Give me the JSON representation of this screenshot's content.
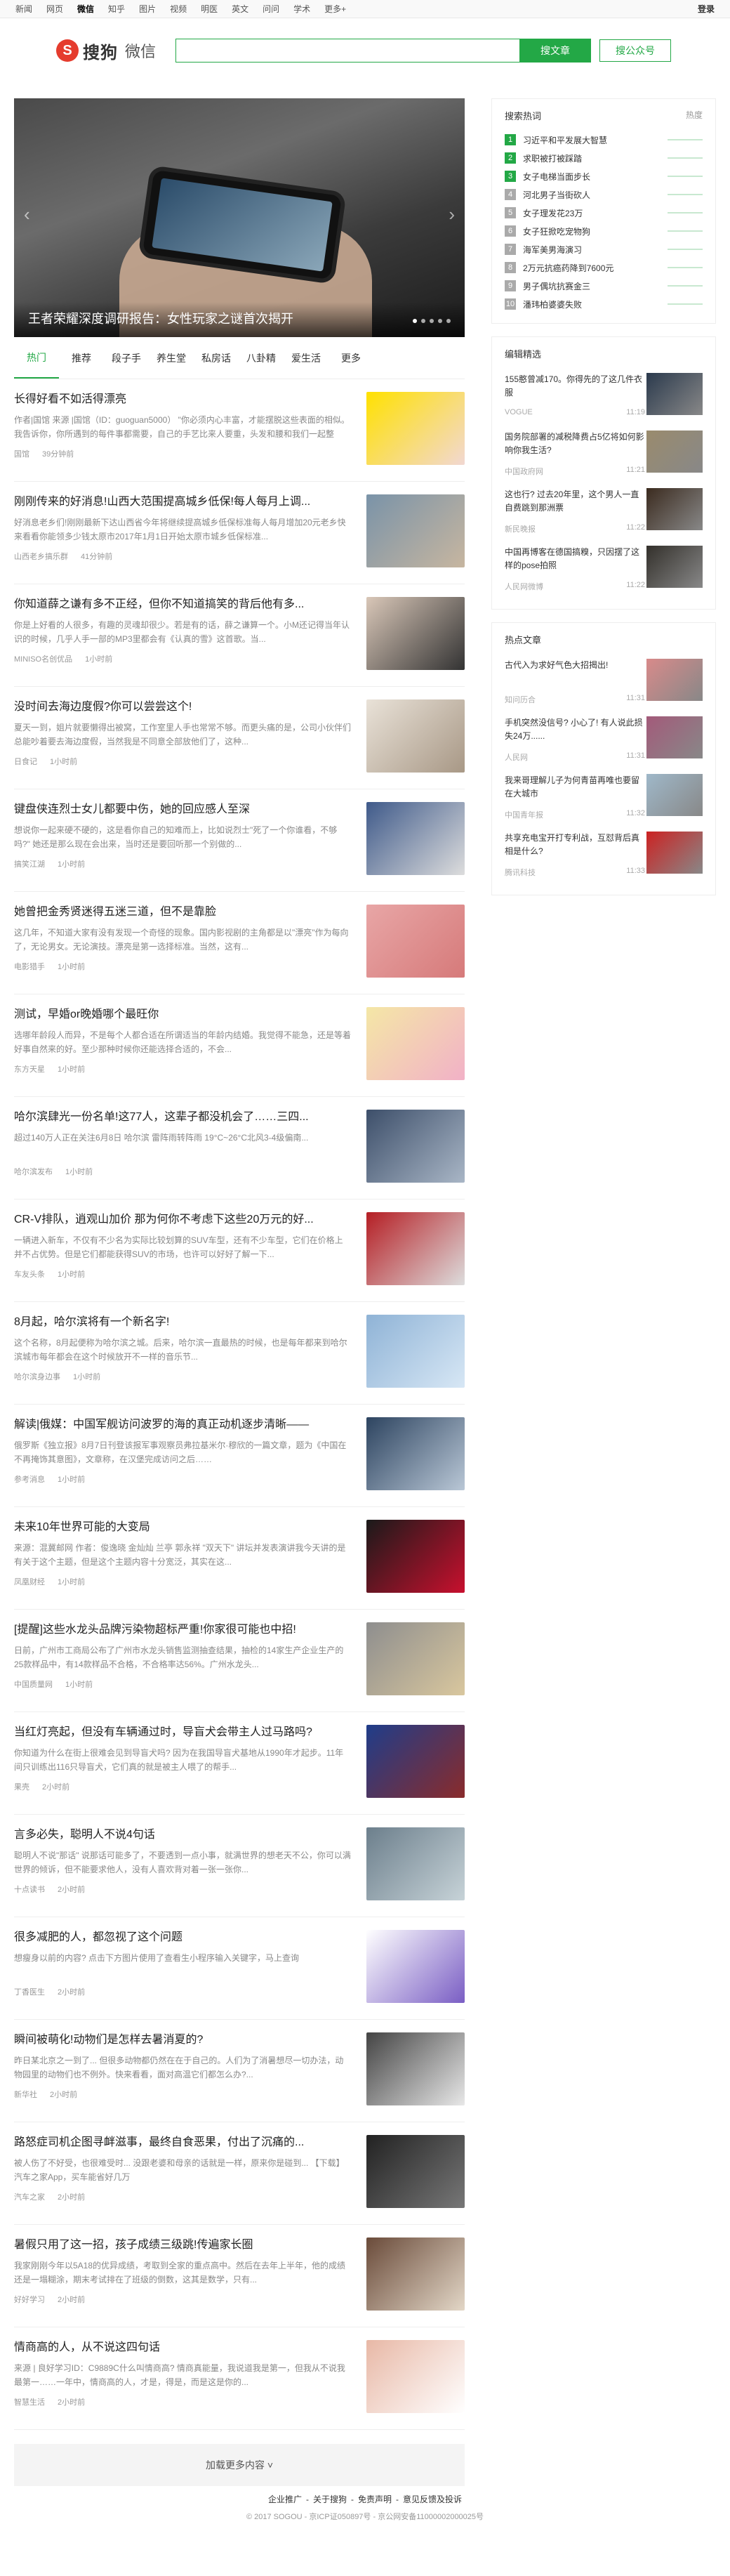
{
  "topnav": {
    "items": [
      "新闻",
      "网页",
      "微信",
      "知乎",
      "图片",
      "视频",
      "明医",
      "英文",
      "问问",
      "学术",
      "更多+"
    ],
    "active_index": 2,
    "login": "登录"
  },
  "brand": {
    "logo_letter": "S",
    "logo_text": "搜狗",
    "logo_sub": "微信"
  },
  "search": {
    "placeholder": "",
    "btn_article": "搜文章",
    "btn_account": "搜公众号"
  },
  "banner": {
    "caption": "王者荣耀深度调研报告：女性玩家之谜首次揭开",
    "prev": "‹",
    "next": "›"
  },
  "tabs": [
    "热门",
    "推荐",
    "段子手",
    "养生堂",
    "私房话",
    "八卦精",
    "爱生活",
    "更多"
  ],
  "tabs_active": 0,
  "feed": [
    {
      "title": "长得好看不如活得漂亮",
      "desc": "作者|国馆 来源 |国馆（ID：guoguan5000） \"你必须内心丰富，才能摆脱这些表面的相似。我告诉你，你所遇到的每件事都需要，自己的手艺比来人要重，头发和腰和我们一起整活...\"",
      "source": "国馆",
      "time": "39分钟前",
      "color": "#ffe100",
      "color2": "#f2d8d2"
    },
    {
      "title": "刚刚传来的好消息!山西大范围提高城乡低保!每人每月上调...",
      "desc": "好消息老乡们!刚刚最新下达山西省今年将继续提高城乡低保标准每人每月增加20元老乡快来看看你能领多少钱太原市2017年1月1日开始太原市城乡低保标准...",
      "source": "山西老乡搞乐群",
      "time": "41分钟前",
      "color": "#7a93a8",
      "color2": "#c7b6a0"
    },
    {
      "title": "你知道薛之谦有多不正经，但你不知道搞笑的背后他有多...",
      "desc": "你是上好看的人很多，有趣的灵魂却很少。若是有的话，薛之谦算一个。小M还记得当年认识的时候，几乎人手一部的MP3里都会有《认真的雪》这首歌。当...",
      "source": "MINISO名创优品",
      "time": "1小时前",
      "color": "#d9c7b8",
      "color2": "#333"
    },
    {
      "title": "没时间去海边度假?你可以尝尝这个!",
      "desc": "夏天一到，姐片就要懒得出被窝，工作室里人手也常常不够。而更头痛的是，公司小伙伴们总能吵着要去海边度假，当然我是不同意全部放他们了，这种...",
      "source": "日食记",
      "time": "1小时前",
      "color": "#e9e2d8",
      "color2": "#a89886"
    },
    {
      "title": "键盘侠连烈士女儿都要中伤，她的回应感人至深",
      "desc": "想说你一起来硬不硬的，这是看你自己的知难而上，比如说烈士\"死了一个你谁看，不够吗?\" 她还是那么现在会出来，当时还是要回听那一个别做的...",
      "source": "搞笑江湖",
      "time": "1小时前",
      "color": "#3f5a8a",
      "color2": "#ddd"
    },
    {
      "title": "她曾把金秀贤迷得五迷三道，但不是靠脸",
      "desc": "这几年，不知道大家有没有发现一个奇怪的现象。国内影视剧的主角都是以\"漂亮\"作为每向了，无论男女。无论演技。漂亮是第一选择标准。当然，这有...",
      "source": "电影猎手",
      "time": "1小时前",
      "color": "#e8a6a6",
      "color2": "#d67a7a"
    },
    {
      "title": "测试，早婚or晚婚哪个最旺你",
      "desc": "选哪年龄段人而异，不是每个人都合适在所谓适当的年龄内结婚。我觉得不能急，还是等着好事自然来的好。至少那种时候你还能选择合适的，不会...",
      "source": "东方天星",
      "time": "1小时前",
      "color": "#f4e7a6",
      "color2": "#f2b1c7"
    },
    {
      "title": "哈尔滨肆光一份名单!这77人，这辈子都没机会了……三四...",
      "desc": "超过140万人正在关注6月8日 哈尔滨 雷阵雨转阵雨 19°C~26°C北风3-4级偏南...",
      "source": "哈尔滨发布",
      "time": "1小时前",
      "color": "#3d4f6a",
      "color2": "#a9b6c6"
    },
    {
      "title": "CR-V排队，逍观山加价 那为何你不考虑下这些20万元的好...",
      "desc": "一辆进入新车，不仅有不少名为实际比较划算的SUV车型，还有不少车型，它们在价格上并不占优势。但是它们都能获得SUV的市场，也许可以好好了解一下...",
      "source": "车友头条",
      "time": "1小时前",
      "color": "#b51e24",
      "color2": "#ddd"
    },
    {
      "title": "8月起，哈尔滨将有一个新名字!",
      "desc": "这个名称，8月起便称为哈尔滨之城。后来，哈尔滨一直最热的时候，也是每年都来到哈尔滨城市每年都会在这个时候放开不一样的音乐节...",
      "source": "哈尔滨身边事",
      "time": "1小时前",
      "color": "#8fb3d6",
      "color2": "#d7e7f5"
    },
    {
      "title": "解读|俄媒：中国军舰访问波罗的海的真正动机逐步清晰——",
      "desc": "俄罗斯《独立报》8月7日刊登该报军事观察员弗拉基米尔·穆欣的一篇文章，题为《中国在不再掩饰其意图》，文章称，在汉堡完成访问之后……",
      "source": "参考消息",
      "time": "1小时前",
      "color": "#2d4460",
      "color2": "#b9c7d6"
    },
    {
      "title": "未来10年世界可能的大变局",
      "desc": "来源：混冀邮网 作者：俊逸晓 金灿灿 兰亭 郭永祥 \"双天下\" 讲坛并发表演讲我今天讲的是有关于这个主题，但是这个主题内容十分宽泛，其实在这...",
      "source": "凤凰财经",
      "time": "1小时前",
      "color": "#1a1a1a",
      "color2": "#c8102e"
    },
    {
      "title": "[提醒]这些水龙头品牌污染物超标严重!你家很可能也中招!",
      "desc": "日前，广州市工商局公布了广州市水龙头销售监测抽查结果，抽检的14家生产企业生产的25款样品中，有14款样品不合格，不合格率达56%。广州水龙头...",
      "source": "中国质量网",
      "time": "1小时前",
      "color": "#8e8e8e",
      "color2": "#d9c79e"
    },
    {
      "title": "当红灯亮起，但没有车辆通过时，导盲犬会带主人过马路吗?",
      "desc": "你知道为什么在街上很难会见到导盲犬吗? 因为在我国导盲犬基地从1990年才起步。11年间只训练出116只导盲犬，它们真的就是被主人喂了的帮手...",
      "source": "果壳",
      "time": "2小时前",
      "color": "#1f3d8a",
      "color2": "#8a2b2b"
    },
    {
      "title": "言多必失，聪明人不说4句话",
      "desc": "聪明人不说\"那话\" 说那话可能多了，不要透到一点小事，就满世界的想老天不公，你可以满世界的倾诉，但不能要求他人，没有人喜欢背对着一张一张你...",
      "source": "十点读书",
      "time": "2小时前",
      "color": "#6c7f8c",
      "color2": "#c7d3d8"
    },
    {
      "title": "很多减肥的人，都忽视了这个问题",
      "desc": "想瘦身以前的内容? 点击下方图片使用了查看生小程序输入关键字，马上查询",
      "source": "丁香医生",
      "time": "2小时前",
      "color": "#fff",
      "color2": "#7a5ec4"
    },
    {
      "title": "瞬间被萌化!动物们是怎样去暑消夏的?",
      "desc": "昨日某北京之一到了... 但很多动物都仍然在在于自己的。人们为了消暑想尽一切办法，动物园里的动物们也不例外。快来看看，面对高温它们都怎么办?...",
      "source": "新华社",
      "time": "2小时前",
      "color": "#444",
      "color2": "#e8e8e8"
    },
    {
      "title": "路怒症司机企图寻衅滋事，最终自食恶果，付出了沉痛的...",
      "desc": "被人伤了不好受，也很难受时... 没跟老婆和母亲的话就是一样，原来你是碰到... 【下载】 汽车之家App，买车能省好几万",
      "source": "汽车之家",
      "time": "2小时前",
      "color": "#222",
      "color2": "#777"
    },
    {
      "title": "暑假只用了这一招，孩子成绩三级跳!传遍家长圈",
      "desc": "我家刚刚今年以5A18的优异成绩，考取到全家的重点高中。然后在去年上半年，他的成绩还是一塌糊涂，期末考试排在了班级的倒数，这其是数学，只有...",
      "source": "好好学习",
      "time": "2小时前",
      "color": "#6a4b3a",
      "color2": "#e3d7c7"
    },
    {
      "title": "情商高的人，从不说这四句话",
      "desc": "来源 | 良好学习ID：C9889C什么叫情商高? 情商真能量，我说道我是第一，但我从不说我最第一……一年中，情商高的人，才是，得是，而是这是你的...",
      "source": "智慧生活",
      "time": "2小时前",
      "color": "#e8b8a6",
      "color2": "#fff"
    }
  ],
  "load_more": "加载更多内容",
  "hot_search": {
    "title": "搜索热词",
    "col": "热度",
    "items": [
      "习近平和平发展大智慧",
      "求职被打被踩踏",
      "女子电梯当面步长",
      "河北男子当街砍人",
      "女子理发花23万",
      "女子狂掀吃宠物狗",
      "海军美男海演习",
      "2万元抗癌药降到7600元",
      "男子偶坑抗赛金三",
      "潘玮柏婆婆失败"
    ]
  },
  "edit_picks": {
    "title": "编辑精选",
    "items": [
      {
        "t": "155憨曾减170。你得先的了这几件衣服",
        "s": "VOGUE",
        "time": "11:19",
        "color": "#2b3a4d"
      },
      {
        "t": "国务院部署的减税降费占5亿将如何影响你我生活?",
        "s": "中国政府网",
        "time": "11:21",
        "color": "#9a8b6d"
      },
      {
        "t": "这也行? 过去20年里，这个男人一直自费跳到那洲票",
        "s": "新民晚报",
        "time": "11:22",
        "color": "#3b2b1f"
      },
      {
        "t": "中国再博客在德国搞糗，只因摆了这样的pose拍照",
        "s": "人民网微博",
        "time": "11:22",
        "color": "#33302b"
      }
    ]
  },
  "hot_articles": {
    "title": "热点文章",
    "items": [
      {
        "t": "古代入为求好气色大招揭出!",
        "s": "知问历合",
        "time": "11:31",
        "color": "#d88a8a"
      },
      {
        "t": "手机突然没信号? 小心了! 有人说此损失24万......",
        "s": "人民网",
        "time": "11:31",
        "color": "#a35a7a"
      },
      {
        "t": "我来哥理解儿子为何青苗再唯也要留在大城市",
        "s": "中国青年报",
        "time": "11:32",
        "color": "#9fb8c9"
      },
      {
        "t": "共享充电宝开打专利战，互怼背后真相是什么?",
        "s": "腾讯科技",
        "time": "11:33",
        "color": "#c22"
      }
    ]
  },
  "footer": {
    "links": [
      "企业推广",
      "关于搜狗",
      "免责声明",
      "意见反馈及投诉"
    ],
    "copy": "© 2017 SOGOU - 京ICP证050897号 - 京公网安备11000002000025号"
  }
}
